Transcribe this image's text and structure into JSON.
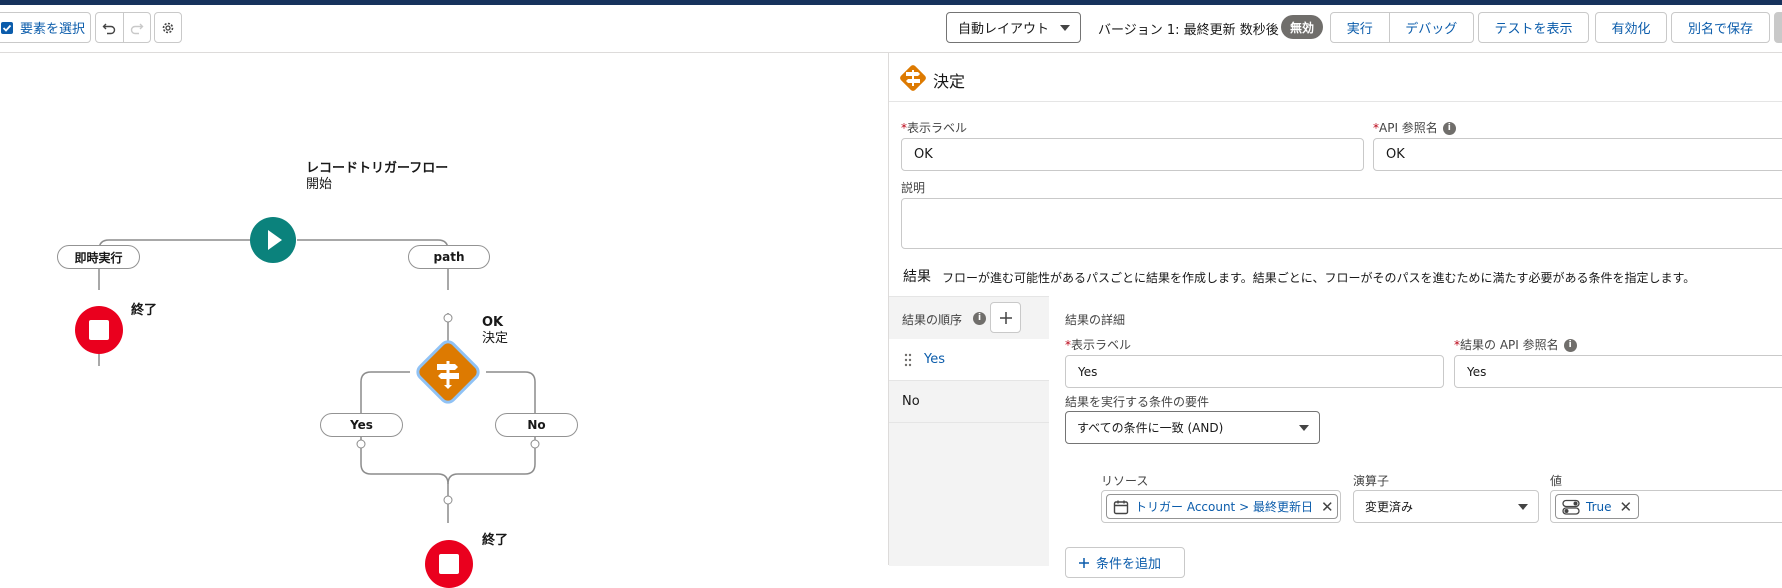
{
  "toolbar": {
    "select_elements": "要素を選択",
    "layout_select": "自動レイアウト",
    "version_text": "バージョン 1: 最終更新 数秒後",
    "status_badge": "無効",
    "run": "実行",
    "debug": "デバッグ",
    "show_tests": "テストを表示",
    "activate": "有効化",
    "save_as": "別名で保存"
  },
  "canvas": {
    "start_title": "レコードトリガーフロー",
    "start_subtitle": "開始",
    "branch_left": "即時実行",
    "branch_right": "path",
    "end_label_1": "終了",
    "decision_title": "OK",
    "decision_subtitle": "決定",
    "outcome_yes": "Yes",
    "outcome_no": "No",
    "end_label_2": "終了"
  },
  "panel": {
    "header_title": "決定",
    "label_field_label": "表示ラベル",
    "label_value": "OK",
    "api_field_label": "API 参照名",
    "api_value": "OK",
    "description_label": "説明",
    "description_value": "",
    "results_heading": "結果",
    "results_help": "フローが進む可能性があるパスごとに結果を作成します。結果ごとに、フローがそのパスを進むために満たす必要がある条件を指定します。",
    "outcome_order_label": "結果の順序",
    "outcome_items": [
      "Yes",
      "No"
    ],
    "details_heading": "結果の詳細",
    "outcome_label_label": "表示ラベル",
    "outcome_label_value": "Yes",
    "outcome_api_label": "結果の API 参照名",
    "outcome_api_value": "Yes",
    "condition_req_label": "結果を実行する条件の要件",
    "condition_req_value": "すべての条件に一致 (AND)",
    "resource_label": "リソース",
    "resource_value": "トリガー Account > 最終更新日",
    "operator_label": "演算子",
    "operator_value": "変更済み",
    "value_label": "値",
    "value_value": "True",
    "add_condition": "条件を追加"
  },
  "colors": {
    "start_node": "#0b827c",
    "end_node": "#ea001e",
    "decision_node": "#dd7a01",
    "link": "#0b5cab"
  },
  "icons": [
    "checkbox-icon",
    "undo-icon",
    "redo-icon",
    "gear-icon",
    "play-icon",
    "stop-icon",
    "decision-icon",
    "info-icon",
    "plus-icon",
    "drag-handle-icon",
    "calendar-icon",
    "toggle-icon",
    "close-icon",
    "chevron-down-icon"
  ]
}
